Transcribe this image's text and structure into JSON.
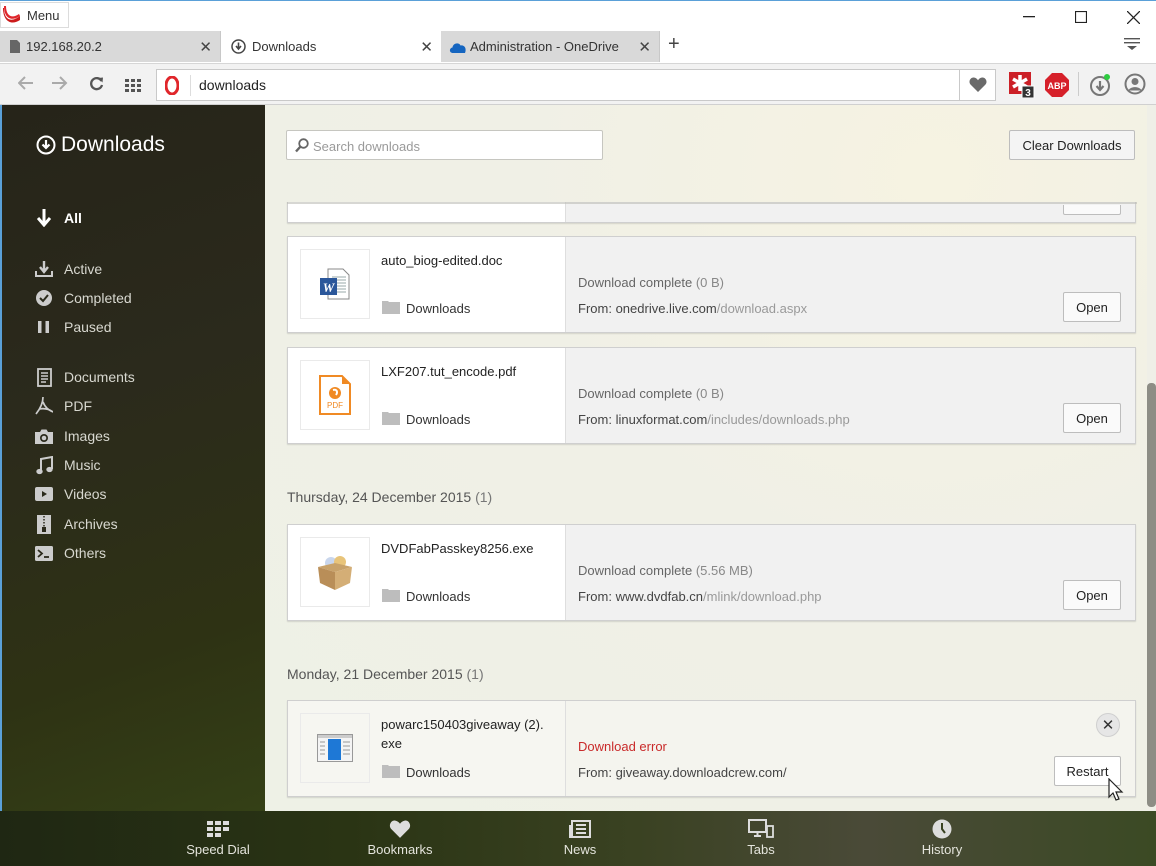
{
  "titlebar": {
    "menu_label": "Menu",
    "controls": [
      "minimize",
      "maximize",
      "close"
    ]
  },
  "tabs": [
    {
      "title": "192.168.20.2",
      "icon": "page-icon",
      "active": false
    },
    {
      "title": "Downloads",
      "icon": "download-icon",
      "active": true
    },
    {
      "title": "Administration - OneDrive",
      "icon": "onedrive-cloud-icon",
      "active": false
    }
  ],
  "addressbar": {
    "url": "downloads",
    "extensions": [
      {
        "name": "lastpass",
        "badge": "3",
        "color": "#cc2027"
      },
      {
        "name": "adblock-plus",
        "label": "ABP",
        "color": "#d6202a"
      },
      {
        "name": "downloads-indicator",
        "dot_color": "#2ecc40"
      },
      {
        "name": "account"
      }
    ]
  },
  "sidebar": {
    "title": "Downloads",
    "filters": [
      {
        "label": "All",
        "icon": "arrow-down-icon",
        "selected": true
      },
      {
        "label": "Active",
        "icon": "download-tray-icon"
      },
      {
        "label": "Completed",
        "icon": "check-circle-icon"
      },
      {
        "label": "Paused",
        "icon": "pause-icon"
      }
    ],
    "categories": [
      {
        "label": "Documents",
        "icon": "document-icon"
      },
      {
        "label": "PDF",
        "icon": "pdf-icon"
      },
      {
        "label": "Images",
        "icon": "camera-icon"
      },
      {
        "label": "Music",
        "icon": "music-note-icon"
      },
      {
        "label": "Videos",
        "icon": "video-play-icon"
      },
      {
        "label": "Archives",
        "icon": "archive-zip-icon"
      },
      {
        "label": "Others",
        "icon": "terminal-icon"
      }
    ]
  },
  "main": {
    "search_placeholder": "Search downloads",
    "search_value": "",
    "clear_label": "Clear Downloads",
    "groups": [
      {
        "date": null,
        "items": [
          {
            "filename": "auto_biog-edited.doc",
            "icon": "word-doc-icon",
            "folder": "Downloads",
            "status": "Download complete",
            "size": "(0 B)",
            "from_label": "From:",
            "from_host": "onedrive.live.com",
            "from_path": "/download.aspx",
            "action": "Open"
          },
          {
            "filename": "LXF207.tut_encode.pdf",
            "icon": "pdf-file-icon",
            "folder": "Downloads",
            "status": "Download complete",
            "size": "(0 B)",
            "from_label": "From:",
            "from_host": "linuxformat.com",
            "from_path": "/includes/downloads.php",
            "action": "Open"
          }
        ]
      },
      {
        "date": "Thursday, 24 December 2015",
        "count": "(1)",
        "items": [
          {
            "filename": "DVDFabPasskey8256.exe",
            "icon": "installer-box-icon",
            "folder": "Downloads",
            "status": "Download complete",
            "size": "(5.56 MB)",
            "from_label": "From:",
            "from_host": "www.dvdfab.cn",
            "from_path": "/mlink/download.php",
            "action": "Open"
          }
        ]
      },
      {
        "date": "Monday, 21 December 2015",
        "count": "(1)",
        "items": [
          {
            "filename": "powarc150403giveaway (2).exe",
            "filename_line1": "powarc150403giveaway (2).",
            "filename_line2": "exe",
            "icon": "app-window-icon",
            "folder": "Downloads",
            "status": "Download error",
            "size": "",
            "from_label": "From:",
            "from_host": "giveaway.downloadcrew.com/",
            "from_path": "",
            "action": "Restart",
            "error": true
          }
        ]
      }
    ]
  },
  "bottombar": [
    {
      "label": "Speed Dial",
      "icon": "speed-dial-grid-icon"
    },
    {
      "label": "Bookmarks",
      "icon": "heart-icon"
    },
    {
      "label": "News",
      "icon": "news-icon"
    },
    {
      "label": "Tabs",
      "icon": "devices-icon"
    },
    {
      "label": "History",
      "icon": "clock-icon"
    }
  ],
  "colors": {
    "accent_red": "#cc1b1b",
    "error_text": "#c92a2a",
    "window_border": "#5aa0d8"
  }
}
